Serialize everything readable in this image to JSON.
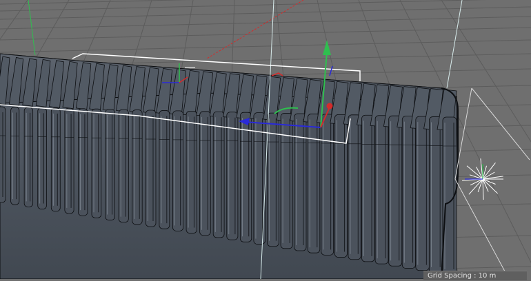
{
  "viewport": {
    "grid_spacing_label": "Grid Spacing : 10 m"
  },
  "colors": {
    "background": "#6f6f6f",
    "grid_line": "#5a5a5a",
    "object_body": "#4e5560",
    "object_edge": "#0d0f12",
    "object_highlight": "#7e8792",
    "axis_x": "#d42b2b",
    "axis_y": "#2fbf4f",
    "axis_z": "#2a2ad8",
    "selection_box": "#ffffff",
    "camera_line": "#d6d6d6",
    "view_axis_line": "#cfe8e8"
  },
  "icons": [
    "move-gizmo-icon",
    "local-axis-icon",
    "light-source-icon"
  ]
}
